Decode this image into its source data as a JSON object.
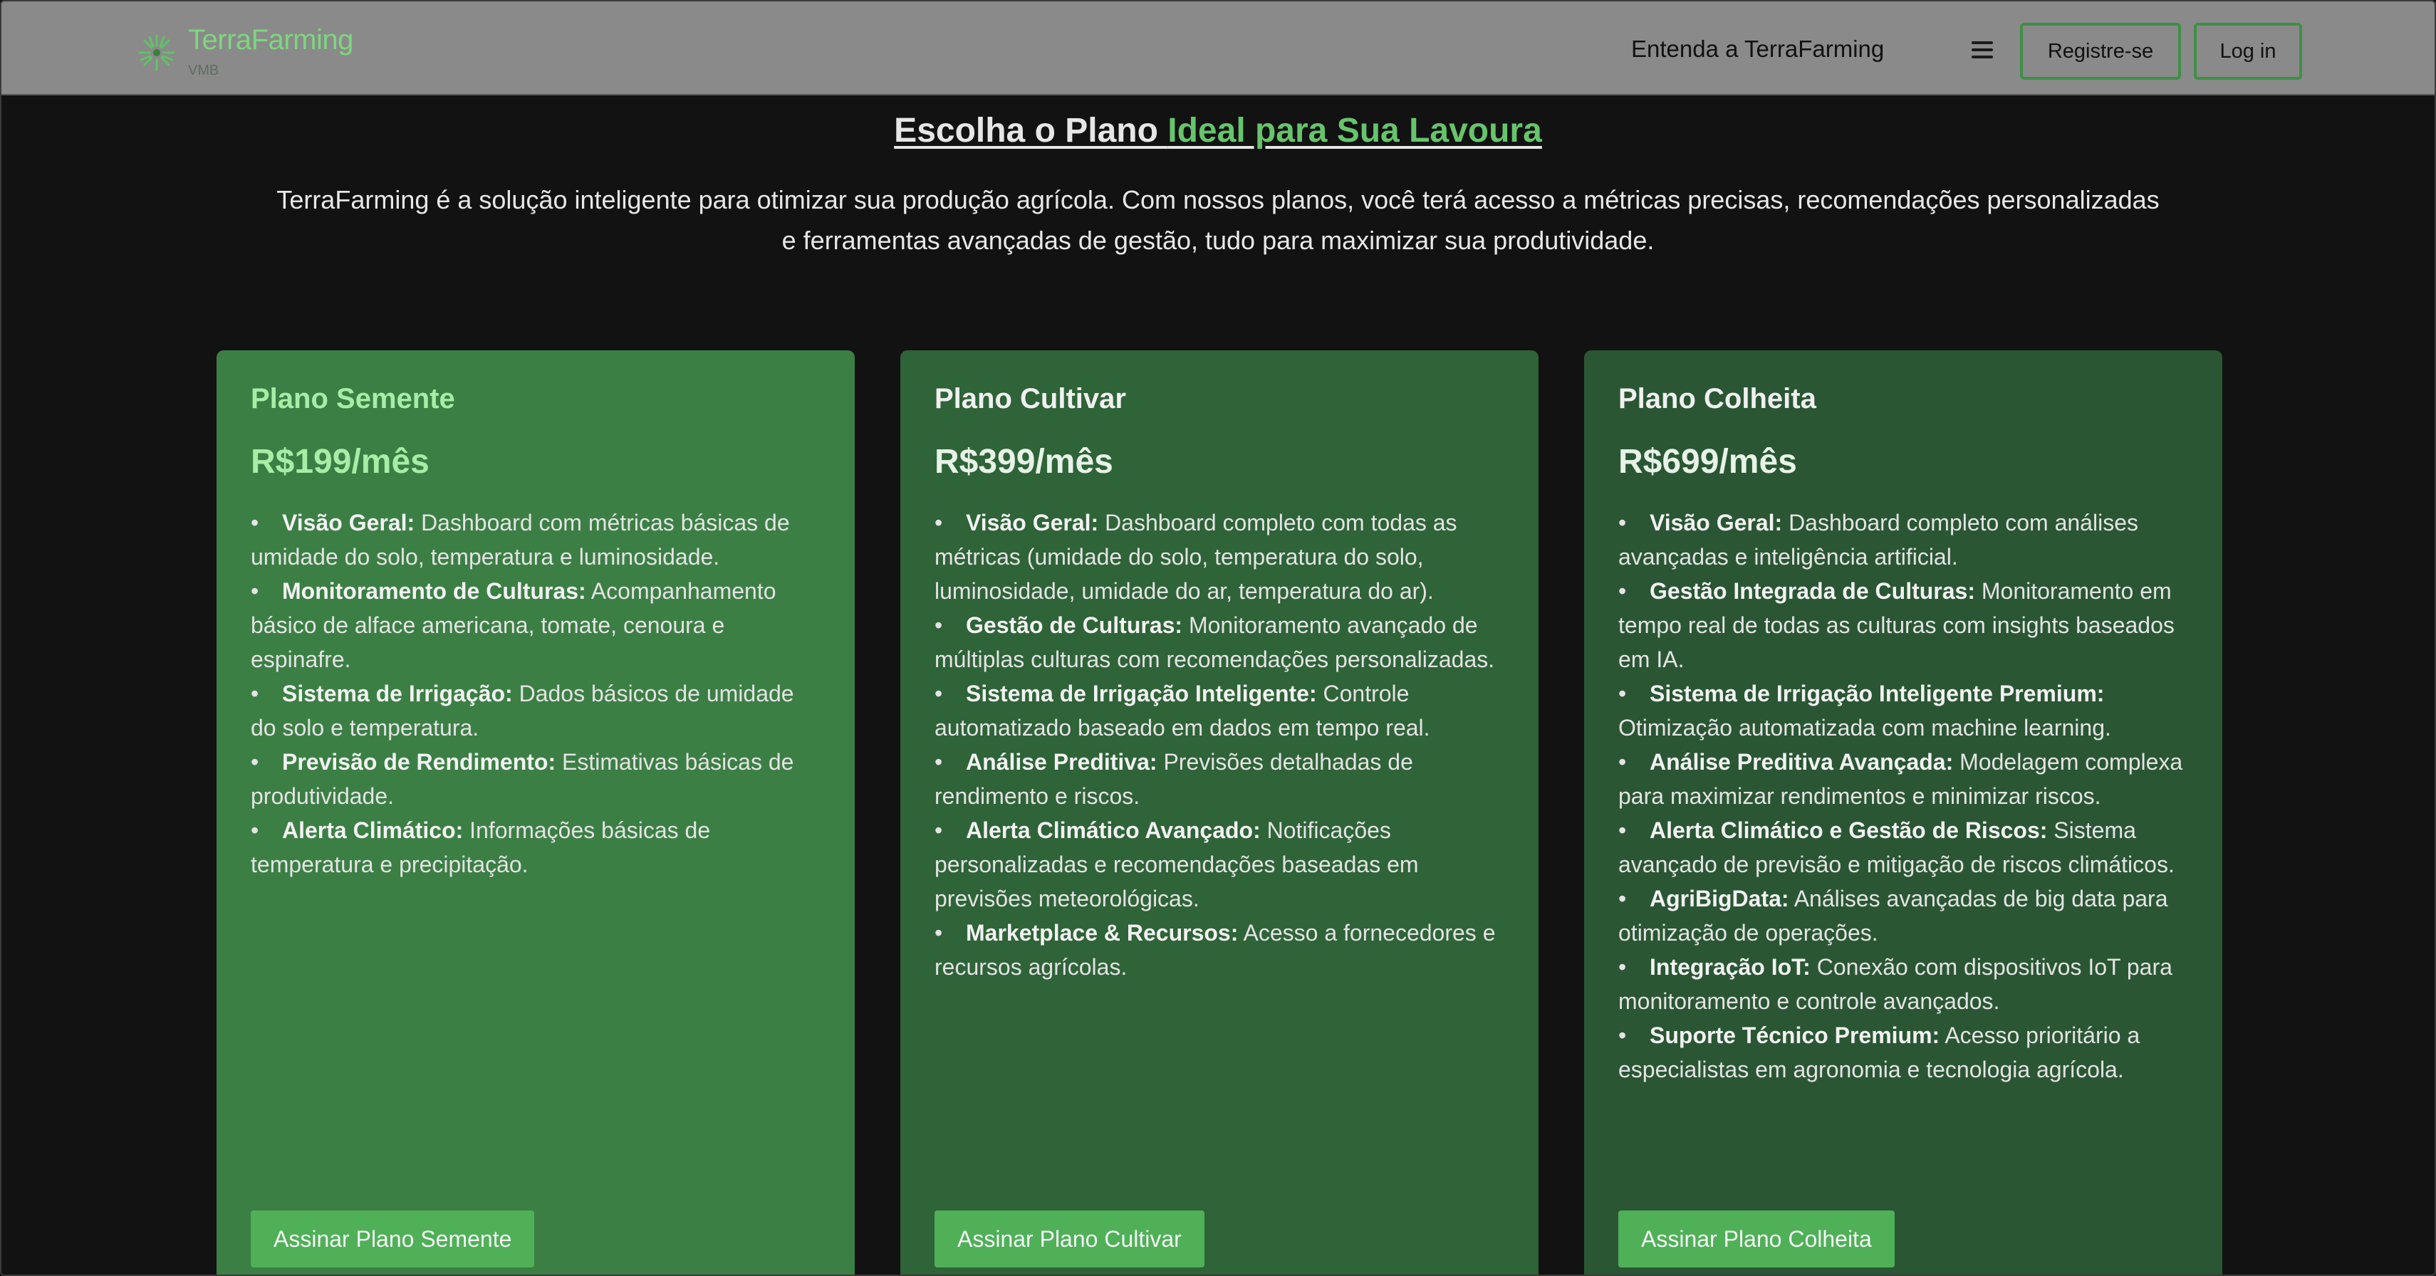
{
  "brand": {
    "name": "TerraFarming",
    "sub": "VMB",
    "icon": "sprout-burst-icon",
    "accent_color": "#67c46c"
  },
  "nav": {
    "about_link": "Entenda a TerraFarming",
    "menu_icon": "hamburger-icon",
    "register_label": "Registre-se",
    "login_label": "Log in"
  },
  "hero": {
    "title_prefix": "Escolha o Plano ",
    "title_accent": "Ideal para Sua Lavoura",
    "description": "TerraFarming é a solução inteligente para otimizar sua produção agrícola. Com nossos planos, você terá acesso a métricas precisas, recomendações personalizadas e ferramentas avançadas de gestão, tudo para maximizar sua produtividade."
  },
  "plans": [
    {
      "name": "Plano Semente",
      "price": "R$199/mês",
      "features": [
        {
          "title": "Visão Geral:",
          "text": " Dashboard com métricas básicas de umidade do solo, temperatura e luminosidade."
        },
        {
          "title": "Monitoramento de Culturas:",
          "text": " Acompanhamento básico de alface americana, tomate, cenoura e espinafre."
        },
        {
          "title": "Sistema de Irrigação:",
          "text": " Dados básicos de umidade do solo e temperatura."
        },
        {
          "title": "Previsão de Rendimento:",
          "text": " Estimativas básicas de produtividade."
        },
        {
          "title": "Alerta Climático:",
          "text": " Informações básicas de temperatura e precipitação."
        }
      ],
      "button": "Assinar Plano Semente",
      "color": "#3c7f45"
    },
    {
      "name": "Plano Cultivar",
      "price": "R$399/mês",
      "features": [
        {
          "title": "Visão Geral:",
          "text": " Dashboard completo com todas as métricas (umidade do solo, temperatura do solo, luminosidade, umidade do ar, temperatura do ar)."
        },
        {
          "title": "Gestão de Culturas:",
          "text": " Monitoramento avançado de múltiplas culturas com recomendações personalizadas."
        },
        {
          "title": "Sistema de Irrigação Inteligente:",
          "text": " Controle automatizado baseado em dados em tempo real."
        },
        {
          "title": "Análise Preditiva:",
          "text": " Previsões detalhadas de rendimento e riscos."
        },
        {
          "title": "Alerta Climático Avançado:",
          "text": " Notificações personalizadas e recomendações baseadas em previsões meteorológicas."
        },
        {
          "title": "Marketplace & Recursos:",
          "text": " Acesso a fornecedores e recursos agrícolas."
        }
      ],
      "button": "Assinar Plano Cultivar",
      "color": "#2f6338"
    },
    {
      "name": "Plano Colheita",
      "price": "R$699/mês",
      "features": [
        {
          "title": "Visão Geral:",
          "text": " Dashboard completo com análises avançadas e inteligência artificial."
        },
        {
          "title": "Gestão Integrada de Culturas:",
          "text": " Monitoramento em tempo real de todas as culturas com insights baseados em IA."
        },
        {
          "title": "Sistema de Irrigação Inteligente Premium:",
          "text": " Otimização automatizada com machine learning."
        },
        {
          "title": "Análise Preditiva Avançada:",
          "text": " Modelagem complexa para maximizar rendimentos e minimizar riscos."
        },
        {
          "title": "Alerta Climático e Gestão de Riscos:",
          "text": " Sistema avançado de previsão e mitigação de riscos climáticos."
        },
        {
          "title": "AgriBigData:",
          "text": " Análises avançadas de big data para otimização de operações."
        },
        {
          "title": "Integração IoT:",
          "text": " Conexão com dispositivos IoT para monitoramento e controle avançados."
        },
        {
          "title": "Suporte Técnico Premium:",
          "text": " Acesso prioritário a especialistas em agronomia e tecnologia agrícola."
        }
      ],
      "button": "Assinar Plano Colheita",
      "color": "#2a5634"
    }
  ]
}
